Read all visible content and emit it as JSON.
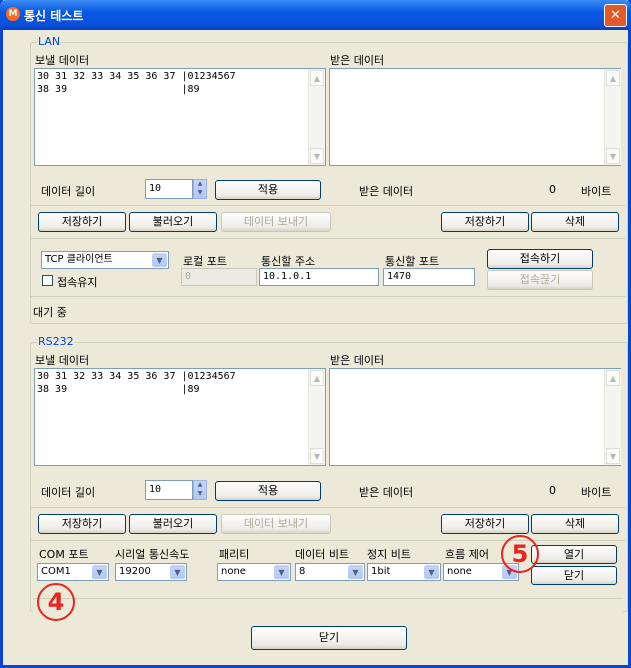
{
  "window": {
    "title": "통신 테스트",
    "app_icon": "M",
    "close": "✕"
  },
  "lan": {
    "group_label": "LAN",
    "send_label": "보낼 데이터",
    "recv_label": "받은 데이터",
    "send_text": "30 31 32 33 34 35 36 37 |01234567\n38 39                   |89",
    "data_length_label": "데이터 길이",
    "data_length_value": "10",
    "apply": "적용",
    "recv_data_label": "받은 데이터",
    "recv_count": "0",
    "bytes": "바이트",
    "save": "저장하기",
    "load": "불러오기",
    "send_data": "데이터 보내기",
    "save_recv": "저장하기",
    "delete": "삭제",
    "mode": "TCP 클라이언트",
    "keep_alive": "접속유지",
    "local_port_label": "로컬 포트",
    "local_port_value": "0",
    "address_label": "통신할 주소",
    "address_value": "10.1.0.1",
    "port_label": "통신할 포트",
    "port_value": "1470",
    "connect": "접속하기",
    "disconnect": "접속끊기",
    "status": "대기 중"
  },
  "rs232": {
    "group_label": "RS232",
    "send_label": "보낼 데이터",
    "recv_label": "받은 데이터",
    "send_text": "30 31 32 33 34 35 36 37 |01234567\n38 39                   |89",
    "data_length_label": "데이터 길이",
    "data_length_value": "10",
    "apply": "적용",
    "recv_data_label": "받은 데이터",
    "recv_count": "0",
    "bytes": "바이트",
    "save": "저장하기",
    "load": "불러오기",
    "send_data": "데이터 보내기",
    "save_recv": "저장하기",
    "delete": "삭제",
    "com_port_label": "COM 포트",
    "com_port_value": "COM1",
    "baud_label": "시리얼 통신속도",
    "baud_value": "19200",
    "parity_label": "패리티",
    "parity_value": "none",
    "data_bits_label": "데이터 비트",
    "data_bits_value": "8",
    "stop_bits_label": "정지 비트",
    "stop_bits_value": "1bit",
    "flow_label": "흐름 제어",
    "flow_value": "none",
    "open": "열기",
    "close": "닫기"
  },
  "close_button": "닫기",
  "annotations": {
    "four": "4",
    "five": "5"
  },
  "icons": {
    "down_arrow": "▼",
    "up_arrow": "▲",
    "spin_up": "▲",
    "spin_down": "▼"
  }
}
